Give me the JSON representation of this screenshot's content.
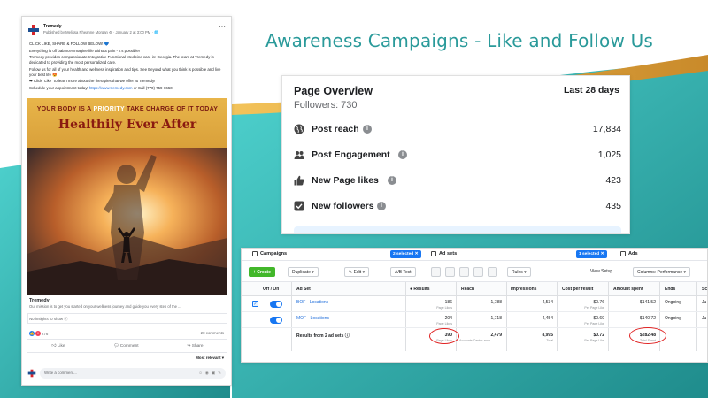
{
  "slide": {
    "title": "Awareness Campaigns - Like and Follow Us",
    "colors": {
      "teal": "#2a9a9a",
      "gold": "#e2a94a",
      "fb_blue": "#1877f2",
      "green": "#42b72a",
      "annotation_red": "#e02424"
    }
  },
  "fb_post": {
    "page_name": "Tremedy",
    "meta": "Published by Melissa Rheanne Morgan ⚙ · January 2 at 3:00 PM · 🌐",
    "text": [
      "CLICK LIKE, SHARE & FOLLOW BELOW! 💙",
      "Everything is off balance! Imagine life without pain - it's possible!",
      "Tremedy provides compassionate Integrative Functional Medicine care in: Georgia. The team at Tremedy is dedicated to providing the most personalized care.",
      "Follow us for all of your health and wellness inspiration and tips. See Beyond what you think is possible and live your best life 😍.",
      "➡ Click \"Like\" to learn more about the therapies that we offer at Tremedy!"
    ],
    "appointment_prefix": "Schedule your appointment today! ",
    "appointment_link": "https://www.tremedy.com",
    "appointment_suffix": " or Call (770) 759-0650",
    "image_line1_a": "YOUR BODY IS A ",
    "image_line1_hl": "PRIORITY",
    "image_line1_b": " TAKE CHARGE OF IT TODAY",
    "image_line2": "Healthily Ever After",
    "link_title": "Tremedy",
    "link_desc": "Our mission is to get you started on your wellness journey and guide you every step of the ...",
    "insights": "No insights to show ⓘ",
    "reactions_count": "276",
    "comments": "20 comments",
    "actions": {
      "like": "Like",
      "comment": "Comment",
      "share": "Share"
    },
    "sort": "Most relevant ▾",
    "comment_placeholder": "Write a comment...",
    "comment_icons": "☺ ◉ ▣ ✎"
  },
  "page_overview": {
    "title": "Page Overview",
    "period": "Last 28 days",
    "followers": "Followers: 730",
    "metrics": [
      {
        "label": "Post reach",
        "value": "17,834",
        "icon": "globe-icon"
      },
      {
        "label": "Post Engagement",
        "value": "1,025",
        "icon": "people-icon"
      },
      {
        "label": "New Page likes",
        "value": "423",
        "icon": "thumbs-up-icon"
      },
      {
        "label": "New followers",
        "value": "435",
        "icon": "follower-check-icon"
      }
    ],
    "info_glyph": "i"
  },
  "ads_manager": {
    "tabs": {
      "campaigns": "Campaigns",
      "adsets": "Ad sets",
      "ads": "Ads"
    },
    "chips": {
      "selected2": "2 selected ✕",
      "selected1": "1 selected ✕"
    },
    "toolbar": {
      "create": "+ Create",
      "duplicate": "Duplicate ▾",
      "edit": "✎ Edit ▾",
      "ab_test": "A/B Test",
      "rules": "Rules ▾",
      "view_setup": "View Setup",
      "columns": "Columns: Performance ▾"
    },
    "headers": {
      "off_on": "Off / On",
      "ad_set": "Ad Set",
      "results": "● Results",
      "reach": "Reach",
      "impressions": "Impressions",
      "cost": "Cost per result",
      "spent": "Amount spent",
      "ends": "Ends",
      "sched": "Sc"
    },
    "rows": [
      {
        "name": "BOF - Locations",
        "results": "186",
        "results_sub": "Page Likes",
        "reach": "1,788",
        "impressions": "4,534",
        "cost": "$0.76",
        "cost_sub": "Per Page Like",
        "spent": "$141.52",
        "ends": "Ongoing",
        "sched": "Ju"
      },
      {
        "name": "MOF - Locations",
        "results": "204",
        "results_sub": "Page Likes",
        "reach": "1,718",
        "impressions": "4,454",
        "cost": "$0.69",
        "cost_sub": "Per Page Like",
        "spent": "$140.72",
        "ends": "Ongoing",
        "sched": "Ju"
      }
    ],
    "total": {
      "name": "Results from 2 ad sets ⓘ",
      "results": "390",
      "results_sub": "Page Likes",
      "reach": "2,479",
      "reach_sub": "Accounts Center acco...",
      "impressions": "8,995",
      "impressions_sub": "Total",
      "cost": "$0.72",
      "cost_sub": "Per Page Like",
      "spent": "$282.48",
      "spent_sub": "Total Spent"
    }
  }
}
